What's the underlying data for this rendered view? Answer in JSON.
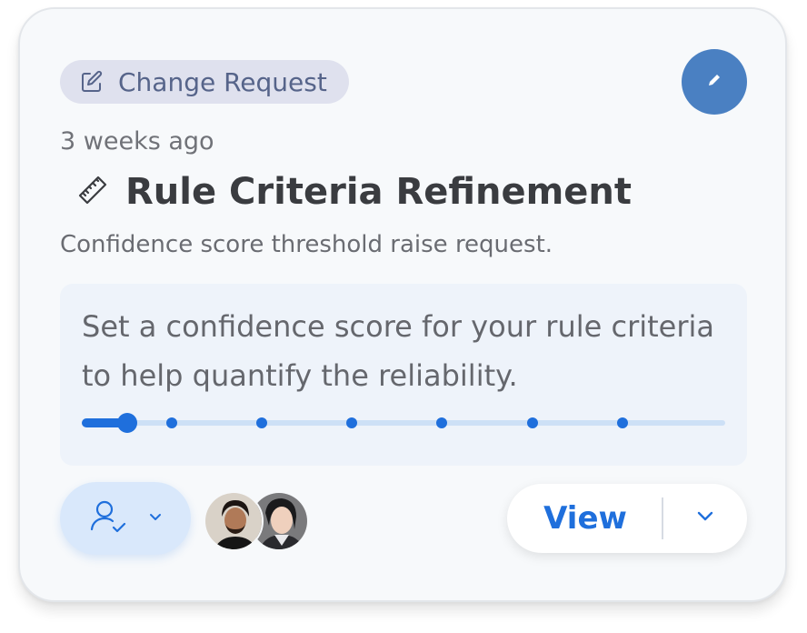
{
  "card": {
    "badge_label": "Change Request",
    "timestamp": "3 weeks ago",
    "title": "Rule Criteria Refinement",
    "subtitle": "Confidence score threshold raise request.",
    "description": "Set a confidence score for your rule criteria to help quantify the reliability.",
    "slider": {
      "value_fraction": 0.07,
      "step_fractions": [
        0.14,
        0.28,
        0.42,
        0.56,
        0.7,
        0.84
      ]
    },
    "view_label": "View"
  },
  "colors": {
    "accent": "#1f6fdc",
    "fab": "#4a80c2",
    "badge_bg": "#dfe1ee",
    "badge_text": "#56648a",
    "panel_bg": "#eef3fa"
  },
  "icons": {
    "badge": "edit-square-icon",
    "fab": "pencil-icon",
    "title": "ruler-icon",
    "assignee": "user-check-icon",
    "assignee_dropdown": "chevron-down-icon",
    "view_dropdown": "chevron-down-icon"
  }
}
